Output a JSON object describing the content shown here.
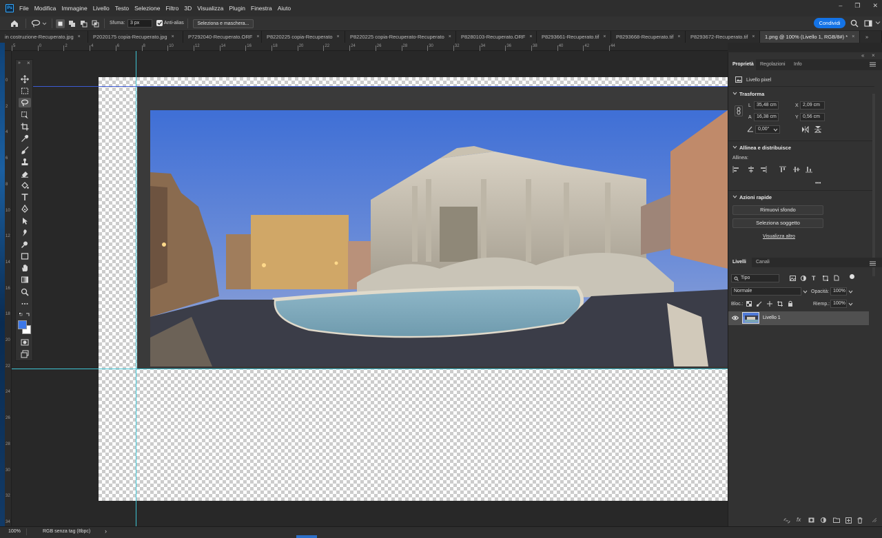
{
  "app": {
    "logo": "Ps"
  },
  "menu": [
    "File",
    "Modifica",
    "Immagine",
    "Livello",
    "Testo",
    "Selezione",
    "Filtro",
    "3D",
    "Visualizza",
    "Plugin",
    "Finestra",
    "Aiuto"
  ],
  "window_controls": {
    "minimize": "–",
    "restore": "❐",
    "close": "✕"
  },
  "options": {
    "feather_label": "Sfuma:",
    "feather_value": "3 px",
    "antialias_label": "Anti-alias",
    "antialias_checked": true,
    "select_mask_button": "Seleziona e maschera...",
    "share_button": "Condividi"
  },
  "tabs": [
    {
      "label": "in costruzione-Recuperato.jpg",
      "active": false
    },
    {
      "label": "P2020175  copia-Recuperato.jpg",
      "active": false
    },
    {
      "label": "P7292040-Recuperato.ORF",
      "active": false
    },
    {
      "label": "P8220225 copia-Recuperato",
      "active": false
    },
    {
      "label": "P8220225 copia-Recuperato-Recuperato",
      "active": false
    },
    {
      "label": "P8280103-Recuperato.ORF",
      "active": false
    },
    {
      "label": "P8293661-Recuperato.tif",
      "active": false
    },
    {
      "label": "P8293668-Recuperato.tif",
      "active": false
    },
    {
      "label": "P8293672-Recuperato.tif",
      "active": false
    },
    {
      "label": "1.png @ 100% (Livello 1, RGB/8#) *",
      "active": true
    }
  ],
  "tab_close": "×",
  "ruler_top": [
    "5",
    "0",
    "2",
    "4",
    "6",
    "8",
    "10",
    "12",
    "14",
    "16",
    "18",
    "20",
    "22",
    "24",
    "26",
    "28",
    "30",
    "32",
    "34",
    "36",
    "38",
    "40",
    "42",
    "44"
  ],
  "ruler_left": [
    "0",
    "2",
    "4",
    "6",
    "8",
    "10",
    "12",
    "14",
    "16",
    "18",
    "20",
    "22",
    "24",
    "26",
    "28",
    "30",
    "32",
    "34"
  ],
  "properties": {
    "tabs": [
      "Proprietà",
      "Regolazioni",
      "Info"
    ],
    "layer_type": "Livello pixel",
    "transform_title": "Trasforma",
    "w_label": "L",
    "w_value": "35,48 cm",
    "x_label": "X",
    "x_value": "2,09 cm",
    "h_label": "A",
    "h_value": "16,38 cm",
    "y_label": "Y",
    "y_value": "0,56 cm",
    "angle_value": "0,00°",
    "align_title": "Allinea e distribuisce",
    "align_label": "Allinea:",
    "more": "•••",
    "quick_title": "Azioni rapide",
    "remove_bg": "Rimuovi sfondo",
    "select_subject": "Seleziona soggetto",
    "show_more": "Visualizza altro"
  },
  "layers_panel": {
    "tabs": [
      "Livelli",
      "Canali"
    ],
    "kind_filter": "Tipo",
    "blend_mode": "Normale",
    "opacity_label": "Opacità:",
    "opacity_value": "100%",
    "lock_label": "Bloc.:",
    "fill_label": "Riemp.:",
    "fill_value": "100%",
    "layers": [
      {
        "name": "Livello 1",
        "visible": true
      }
    ]
  },
  "status": {
    "zoom": "100%",
    "profile": "RGB senza tag (8bpc)",
    "arrow": "›"
  },
  "colors": {
    "foreground": "#3d78e8",
    "background": "#ffffff",
    "accent": "#1473e6",
    "guide": "#3fc6d6"
  }
}
